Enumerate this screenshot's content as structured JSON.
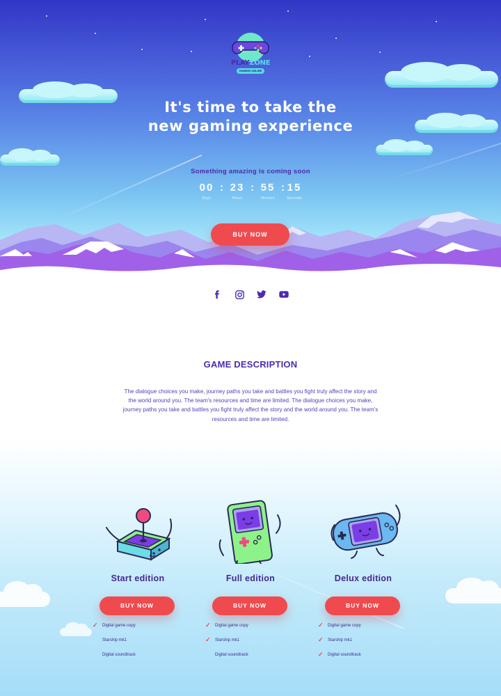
{
  "brand": {
    "name_part1": "PLAY",
    "name_part2": "ZONE",
    "tagline": "GAMING ONLINE"
  },
  "hero": {
    "headline": "It's time to take the new gaming experience",
    "subhead": "Something amazing is coming soon",
    "countdown": [
      {
        "value": "00",
        "label": "Days"
      },
      {
        "value": "23",
        "label": "Hours"
      },
      {
        "value": "55",
        "label": "Minutes"
      },
      {
        "value": "15",
        "label": "Seconds"
      }
    ],
    "separator": ":",
    "cta": "BUY NOW"
  },
  "social": [
    {
      "icon": "facebook-icon"
    },
    {
      "icon": "instagram-icon"
    },
    {
      "icon": "twitter-icon"
    },
    {
      "icon": "youtube-icon"
    }
  ],
  "description": {
    "title": "GAME DESCRIPTION",
    "body": "The dialogue choices you make, journey paths you take and battles you fight truly affect the story and the world around you. The team's resources and time are limited. The dialogue choices you make, journey paths you take and battles you fight truly affect the story and the world around you. The team's resources and time are limited."
  },
  "editions": [
    {
      "name": "Start edition",
      "art": "arcade-joystick",
      "cta": "BUY NOW",
      "features": [
        {
          "label": "Digital game copy",
          "included": true
        },
        {
          "label": "Starship mk1",
          "included": false
        },
        {
          "label": "Digital soundtrack",
          "included": false
        }
      ]
    },
    {
      "name": "Full edition",
      "art": "handheld-console",
      "cta": "BUY NOW",
      "features": [
        {
          "label": "Digital game copy",
          "included": true
        },
        {
          "label": "Starship mk1",
          "included": true
        },
        {
          "label": "Digital soundtrack",
          "included": false
        }
      ]
    },
    {
      "name": "Delux edition",
      "art": "portable-console",
      "cta": "BUY NOW",
      "features": [
        {
          "label": "Digital game copy",
          "included": true
        },
        {
          "label": "Starship mk1",
          "included": true
        },
        {
          "label": "Digital soundtrack",
          "included": true
        }
      ]
    }
  ],
  "colors": {
    "accent": "#ef4b4f",
    "brand_purple": "#4c2bb1",
    "text_purple": "#5541b9",
    "sky_top": "#3236c6",
    "sky_bottom": "#a8e8fb",
    "console_green": "#8ef28a",
    "screen_purple": "#7b3de6"
  }
}
